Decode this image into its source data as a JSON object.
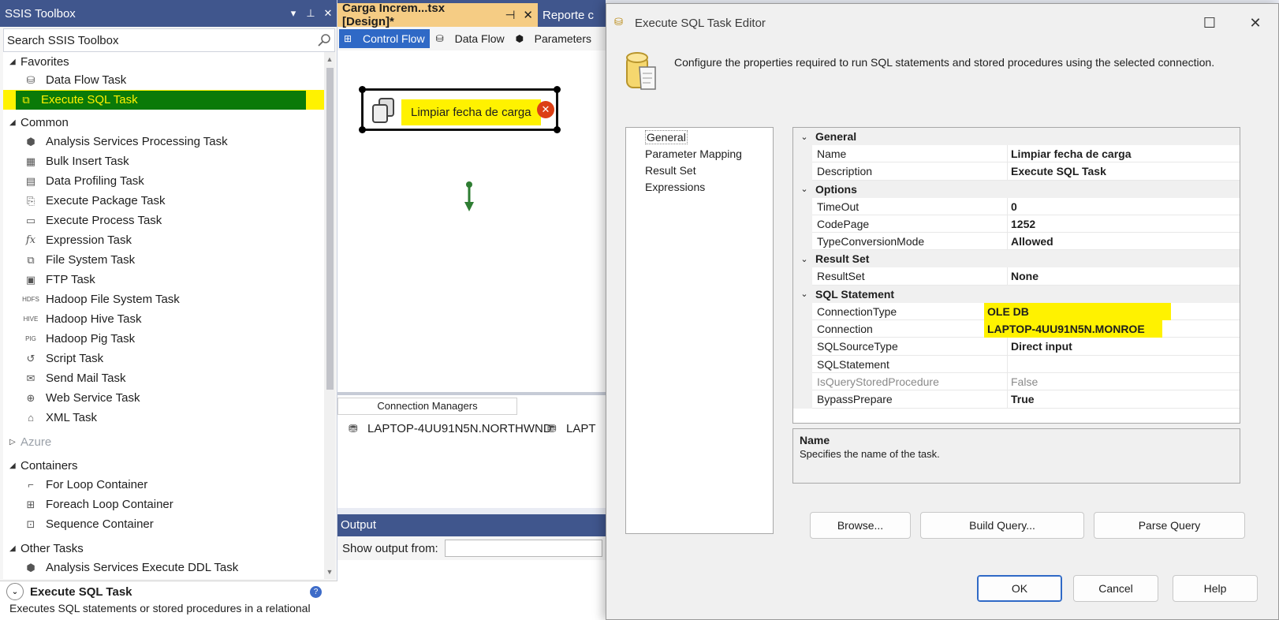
{
  "toolbox": {
    "title": "SSIS Toolbox",
    "search_placeholder": "Search SSIS Toolbox",
    "favorites": {
      "label": "Favorites",
      "items": [
        {
          "label": "Data Flow Task",
          "icon": "data-flow-icon"
        },
        {
          "label": "Execute SQL Task",
          "icon": "execute-sql-icon",
          "selected": true
        }
      ]
    },
    "common": {
      "label": "Common",
      "items": [
        {
          "label": "Analysis Services Processing Task"
        },
        {
          "label": "Bulk Insert Task"
        },
        {
          "label": "Data Profiling Task"
        },
        {
          "label": "Execute Package Task"
        },
        {
          "label": "Execute Process Task"
        },
        {
          "label": "Expression Task"
        },
        {
          "label": "File System Task"
        },
        {
          "label": "FTP Task"
        },
        {
          "label": "Hadoop File System Task"
        },
        {
          "label": "Hadoop Hive Task"
        },
        {
          "label": "Hadoop Pig Task"
        },
        {
          "label": "Script Task"
        },
        {
          "label": "Send Mail Task"
        },
        {
          "label": "Web Service Task"
        },
        {
          "label": "XML Task"
        }
      ]
    },
    "azure": {
      "label": "Azure"
    },
    "containers": {
      "label": "Containers",
      "items": [
        {
          "label": "For Loop Container"
        },
        {
          "label": "Foreach Loop Container"
        },
        {
          "label": "Sequence Container"
        }
      ]
    },
    "other_tasks": {
      "label": "Other Tasks",
      "items": [
        {
          "label": "Analysis Services Execute DDL Task"
        }
      ]
    },
    "description": {
      "title": "Execute SQL Task",
      "text": "Executes SQL statements or stored procedures in a relational"
    }
  },
  "designer": {
    "tabs": [
      {
        "label": "Carga Increm...tsx [Design]*",
        "active": true
      },
      {
        "label": "Reporte c"
      }
    ],
    "sub_tabs": [
      {
        "label": "Control Flow",
        "active": true
      },
      {
        "label": "Data Flow"
      },
      {
        "label": "Parameters"
      }
    ],
    "task": {
      "label": "Limpiar fecha de carga",
      "has_error": true
    },
    "connection_managers": {
      "tab_label": "Connection Managers",
      "items": [
        "LAPTOP-4UU91N5N.NORTHWND",
        "LAPT"
      ]
    },
    "output": {
      "title": "Output",
      "show_from_label": "Show output from:"
    }
  },
  "dialog": {
    "title": "Execute SQL Task Editor",
    "description": "Configure the properties required to run SQL statements and stored procedures using the selected connection.",
    "nav": [
      "General",
      "Parameter Mapping",
      "Result Set",
      "Expressions"
    ],
    "properties": {
      "general": {
        "label": "General",
        "rows": [
          {
            "name": "Name",
            "value": "Limpiar fecha de carga"
          },
          {
            "name": "Description",
            "value": "Execute SQL Task"
          }
        ]
      },
      "options": {
        "label": "Options",
        "rows": [
          {
            "name": "TimeOut",
            "value": "0"
          },
          {
            "name": "CodePage",
            "value": "1252"
          },
          {
            "name": "TypeConversionMode",
            "value": "Allowed"
          }
        ]
      },
      "result_set": {
        "label": "Result Set",
        "rows": [
          {
            "name": "ResultSet",
            "value": "None"
          }
        ]
      },
      "sql_statement": {
        "label": "SQL Statement",
        "rows": [
          {
            "name": "ConnectionType",
            "value": "OLE DB"
          },
          {
            "name": "Connection",
            "value": "LAPTOP-4UU91N5N.MONROE"
          },
          {
            "name": "SQLSourceType",
            "value": "Direct input"
          },
          {
            "name": "SQLStatement",
            "value": ""
          },
          {
            "name": "IsQueryStoredProcedure",
            "value": "False"
          },
          {
            "name": "BypassPrepare",
            "value": "True"
          }
        ]
      }
    },
    "help": {
      "title": "Name",
      "text": "Specifies the name of the task."
    },
    "buttons": {
      "browse": "Browse...",
      "build_query": "Build Query...",
      "parse_query": "Parse Query",
      "ok": "OK",
      "cancel": "Cancel",
      "help": "Help"
    }
  },
  "colors": {
    "title_bar": "#40568d",
    "highlight_yellow": "#fff200",
    "selected_green": "#0a7a08",
    "active_tab": "#f5cc84",
    "control_flow_blue": "#2f69c6"
  }
}
